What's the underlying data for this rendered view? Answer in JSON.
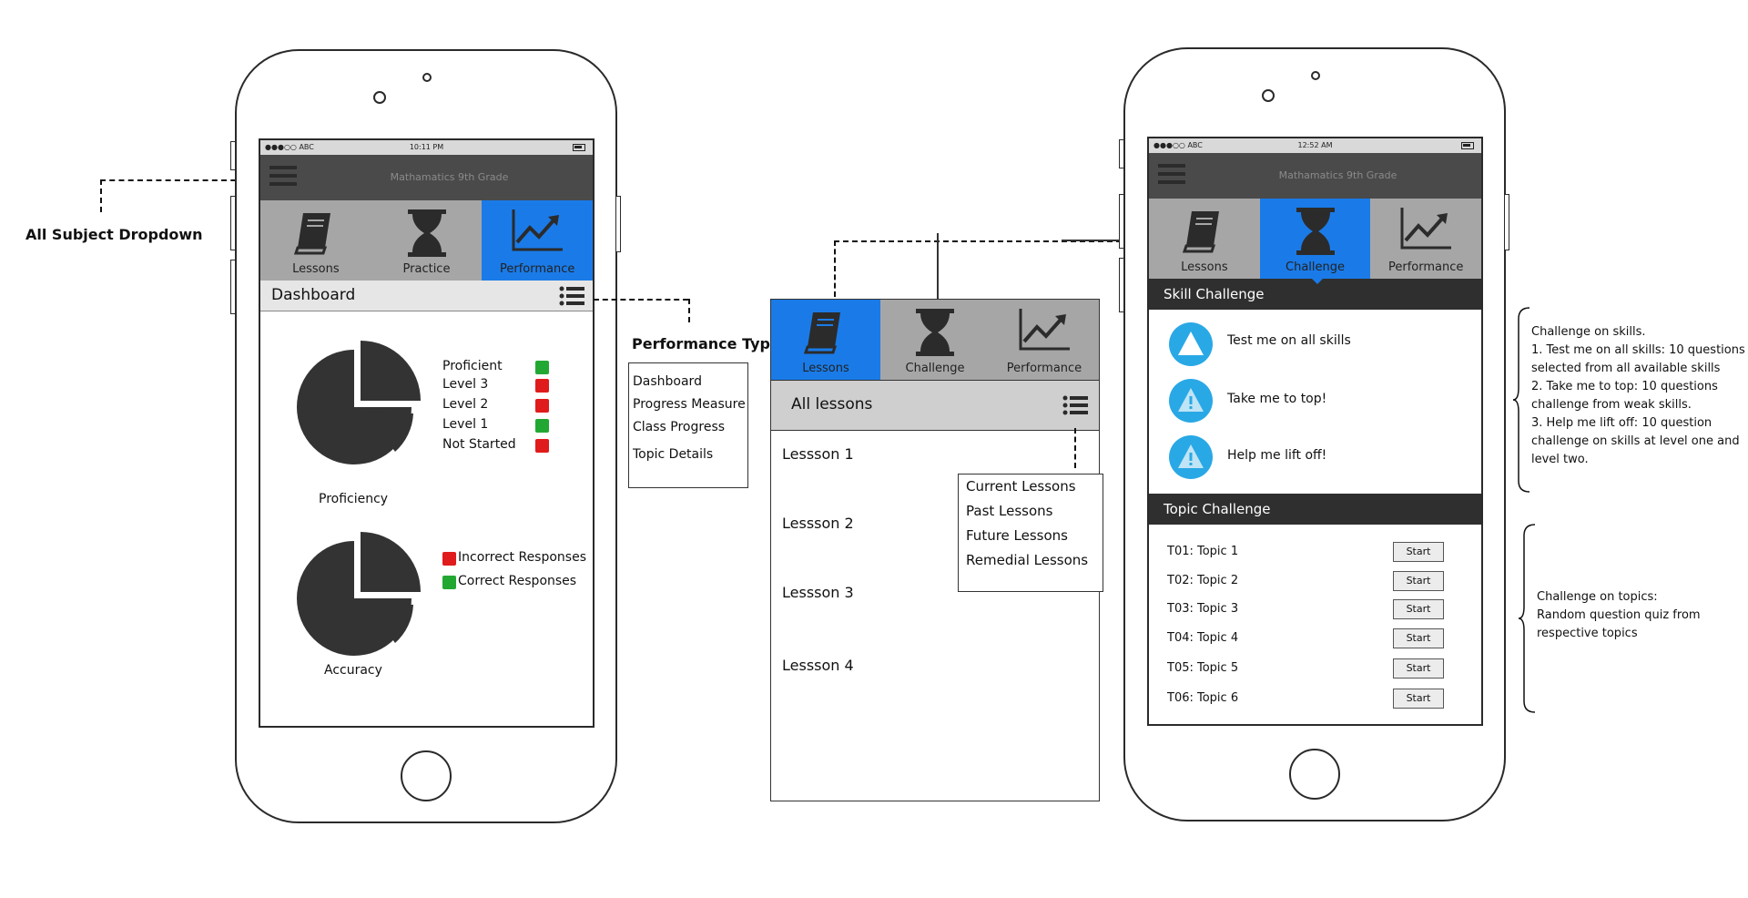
{
  "annotations": {
    "subject_dropdown": "All Subject Dropdown",
    "performance_type": "Performance Type",
    "skills_note": [
      "Challenge on skills.",
      "1. Test me on all skills: 10 questions",
      "selected from all available skills",
      "2. Take me to top: 10 questions",
      "challenge from weak skills.",
      "3. Help me lift off: 10 question",
      "challenge on skills at level one and",
      "level two."
    ],
    "topics_note": [
      "Challenge on topics:",
      "Random question quiz from",
      "respective topics"
    ]
  },
  "performance_menu": [
    "Dashboard",
    "Progress Measure",
    "Class Progress",
    "Topic Details"
  ],
  "phone1": {
    "status": {
      "signal": "●●●○○ ABC",
      "time": "10:11 PM"
    },
    "header_title": "Mathamatics 9th Grade",
    "tabs": [
      "Lessons",
      "Practice",
      "Performance"
    ],
    "active_tab": "Performance",
    "section_title": "Dashboard",
    "proficiency": {
      "caption": "Proficiency",
      "legend": [
        {
          "label": "Proficient",
          "color": "#22a832"
        },
        {
          "label": "Level 3",
          "color": "#e01b1b"
        },
        {
          "label": "Level 2",
          "color": "#e01b1b"
        },
        {
          "label": "Level 1",
          "color": "#22a832"
        },
        {
          "label": "Not Started",
          "color": "#e01b1b"
        }
      ]
    },
    "accuracy": {
      "caption": "Accuracy",
      "legend": [
        {
          "label": "Incorrect Responses",
          "color": "#e01b1b"
        },
        {
          "label": "Correct Responses",
          "color": "#22a832"
        }
      ]
    }
  },
  "lessons_panel": {
    "tabs": [
      "Lessons",
      "Challenge",
      "Performance"
    ],
    "active_tab": "Lessons",
    "section_title": "All lessons",
    "items": [
      "Lessson 1",
      "Lessson 2",
      "Lessson 3",
      "Lessson 4"
    ],
    "filter_menu": [
      "Current Lessons",
      "Past Lessons",
      "Future Lessons",
      "Remedial Lessons"
    ]
  },
  "phone2": {
    "status": {
      "signal": "●●●○○ ABC",
      "time": "12:52 AM"
    },
    "header_title": "Mathamatics 9th Grade",
    "tabs": [
      "Lessons",
      "Challenge",
      "Performance"
    ],
    "active_tab": "Challenge",
    "skill_title": "Skill Challenge",
    "skills": [
      "Test me on all skills",
      "Take me to top!",
      "Help me lift off!"
    ],
    "topic_title": "Topic Challenge",
    "topics": [
      "T01: Topic 1",
      "T02: Topic 2",
      "T03: Topic 3",
      "T04: Topic 4",
      "T05: Topic 5",
      "T06: Topic 6"
    ],
    "start_label": "Start"
  },
  "colors": {
    "active_tab": "#1a7be8",
    "tab_bar": "#a6a6a6",
    "header": "#4a4a4a",
    "green": "#22a832",
    "red": "#e01b1b",
    "skill_icon": "#29a8e6"
  },
  "icons": [
    "hamburger-icon",
    "book-icon",
    "hourglass-icon",
    "trend-chart-icon",
    "list-icon",
    "triangle-icon",
    "warning-icon"
  ]
}
